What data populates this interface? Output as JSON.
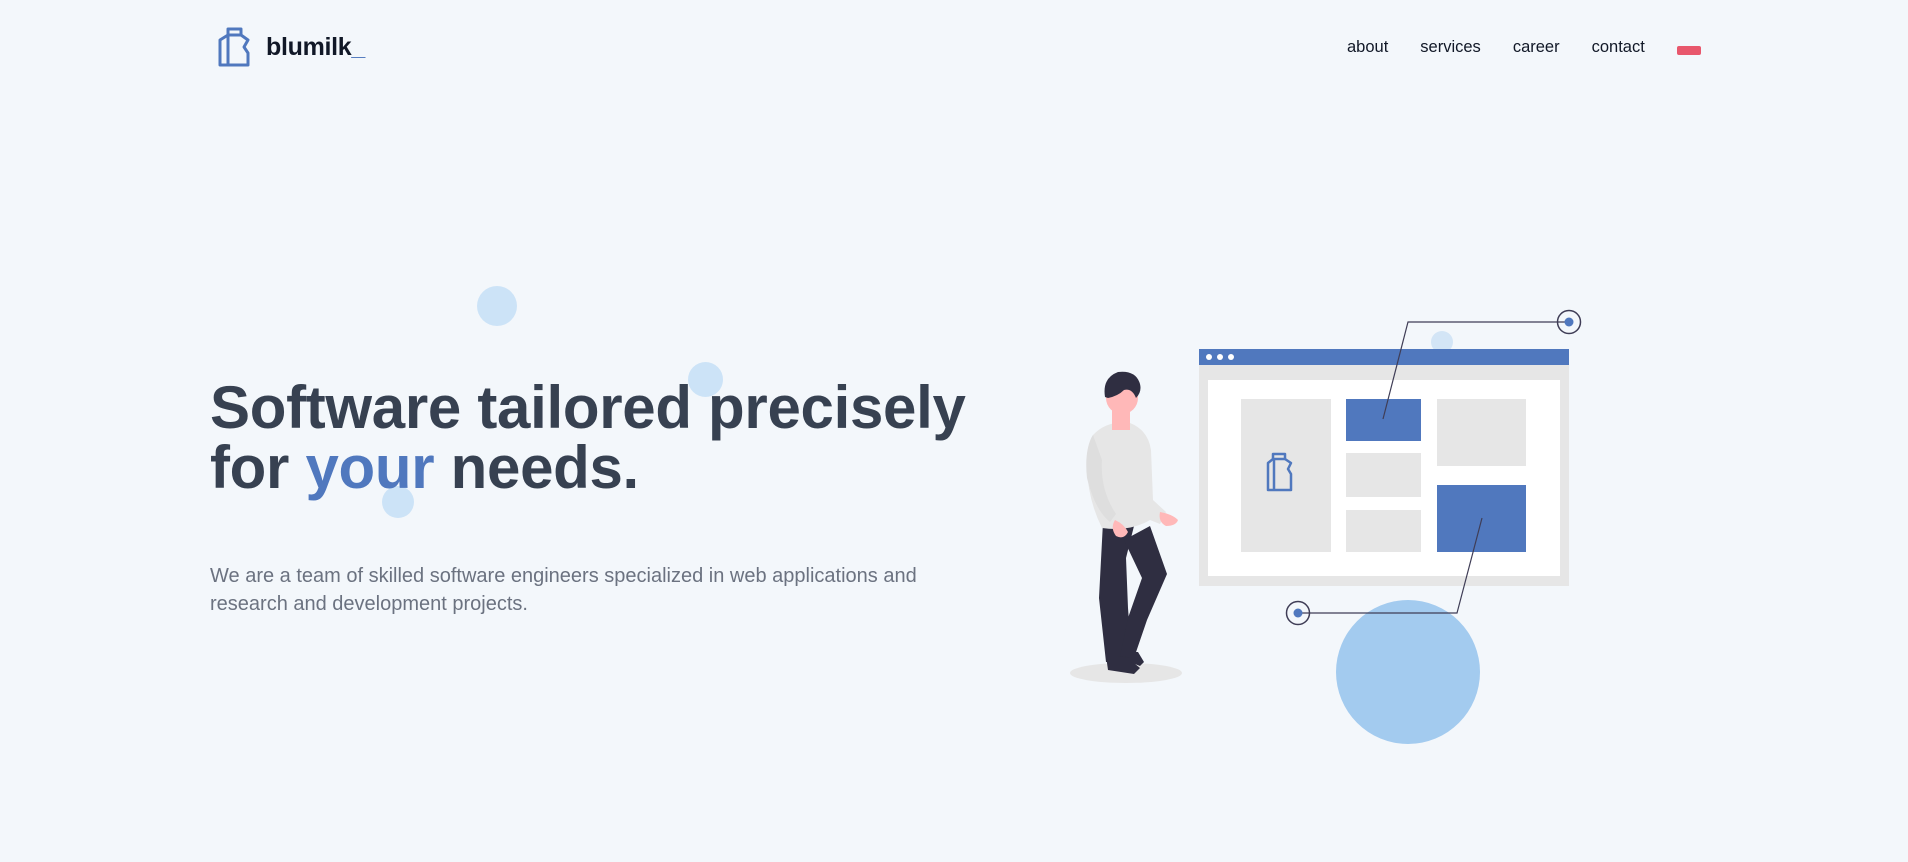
{
  "brand": {
    "name": "blumilk",
    "suffix": "_"
  },
  "nav": {
    "items": [
      {
        "label": "about"
      },
      {
        "label": "services"
      },
      {
        "label": "career"
      },
      {
        "label": "contact"
      }
    ]
  },
  "hero": {
    "title_line1": "Software tailored precisely",
    "title_line2_before": "for ",
    "title_line2_highlight": "your",
    "title_line2_after": " needs.",
    "description": "We are a team of skilled software engineers specialized in web applications and research and development projects."
  },
  "colors": {
    "background": "#f3f7fb",
    "accent": "#5078be",
    "heading": "#374151",
    "text": "#6b7280",
    "flag": "#e8576c",
    "bubble": "#a3cbef"
  },
  "icons": {
    "logo": "milk-carton-icon",
    "language": "language-flag-icon"
  }
}
